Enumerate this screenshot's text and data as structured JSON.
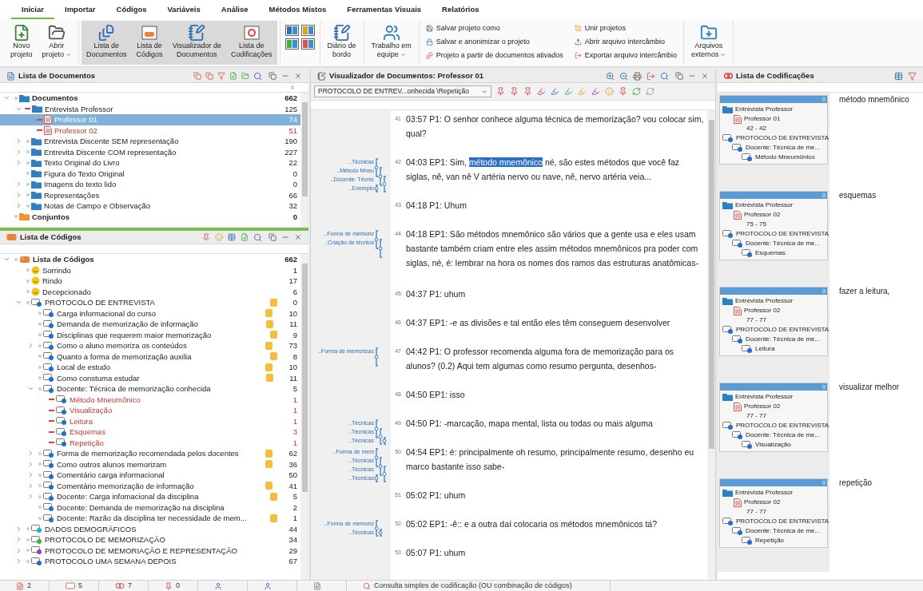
{
  "menu_tabs": [
    {
      "label": "Iniciar",
      "selected": true
    },
    {
      "label": "Importar",
      "selected": false
    },
    {
      "label": "Códigos",
      "selected": false
    },
    {
      "label": "Variáveis",
      "selected": false
    },
    {
      "label": "Análise",
      "selected": false
    },
    {
      "label": "Métodos Mistos",
      "selected": false
    },
    {
      "label": "Ferramentas Visuais",
      "selected": false
    },
    {
      "label": "Relatórios",
      "selected": false
    }
  ],
  "ribbon": [
    {
      "kind": "large",
      "buttons": [
        {
          "lines": [
            "Novo",
            "projeto"
          ],
          "dropdown": false,
          "on": false
        },
        {
          "lines": [
            "Abrir",
            "projeto"
          ],
          "dropdown": true,
          "on": false
        }
      ]
    },
    {
      "kind": "large",
      "buttons": [
        {
          "lines": [
            "Lista de",
            "Documentos"
          ],
          "dropdown": false,
          "on": true
        },
        {
          "lines": [
            "Lista de",
            "Códigos"
          ],
          "dropdown": false,
          "on": true
        },
        {
          "lines": [
            "Visualizador de",
            "Documentos"
          ],
          "dropdown": false,
          "on": true
        },
        {
          "lines": [
            "Lista de",
            "Codificações"
          ],
          "dropdown": false,
          "on": true
        }
      ]
    },
    {
      "kind": "layout_grid"
    },
    {
      "kind": "large",
      "buttons": [
        {
          "lines": [
            "Diário de",
            "bordo"
          ],
          "dropdown": false,
          "on": false
        }
      ]
    },
    {
      "kind": "large",
      "buttons": [
        {
          "lines": [
            "Trabalho em",
            "equipe"
          ],
          "dropdown": true,
          "on": false
        }
      ]
    },
    {
      "kind": "small",
      "columns": [
        [
          "Salvar projeto como",
          "Salvar e anonimizar o projeto",
          "Projeto a partir de documentos ativados"
        ],
        [
          "Unir projetos",
          "Abrir arquivo intercâmbio",
          "Exportar arquivo intercâmbio"
        ]
      ]
    },
    {
      "kind": "large",
      "buttons": [
        {
          "lines": [
            "Arquivos",
            "externos"
          ],
          "dropdown": true,
          "on": false
        }
      ]
    }
  ],
  "documents": {
    "title": "Lista de Documentos",
    "column_header": "#",
    "tree": [
      {
        "name": "Documentos",
        "count": "662",
        "kind": "root",
        "expanded": true,
        "selected": false,
        "children": [
          {
            "name": "Entrevista Professor",
            "count": "125",
            "kind": "folder",
            "expanded": true,
            "activated": true,
            "selected": false,
            "children": [
              {
                "name": "Professor 01",
                "count": "74",
                "kind": "document",
                "activated": true,
                "selected": true
              },
              {
                "name": "Professor 02",
                "count": "51",
                "kind": "document",
                "activated": true,
                "selected": false
              }
            ]
          },
          {
            "name": "Entrevista Discente SEM representação",
            "count": "190",
            "kind": "folder",
            "expanded": false,
            "selected": false
          },
          {
            "name": "Entrevita Discente COM representação",
            "count": "227",
            "kind": "folder",
            "expanded": false,
            "selected": false
          },
          {
            "name": "Texto Original do Livro",
            "count": "22",
            "kind": "folder",
            "expanded": false,
            "selected": false
          },
          {
            "name": "Figura do Texto Original",
            "count": "0",
            "kind": "folder",
            "selected": false
          },
          {
            "name": "Imagens do texto lido",
            "count": "0",
            "kind": "folder",
            "expanded": false,
            "selected": false
          },
          {
            "name": "Representações",
            "count": "66",
            "kind": "folder",
            "expanded": false,
            "selected": false
          },
          {
            "name": "Notas de Campo e Observação",
            "count": "32",
            "kind": "folder",
            "expanded": false,
            "selected": false
          }
        ]
      },
      {
        "name": "Conjuntos",
        "count": "0",
        "kind": "sets",
        "selected": false
      }
    ]
  },
  "codes": {
    "title": "Lista de Códigos",
    "tree": [
      {
        "name": "Lista de Códigos",
        "count": "662",
        "kind": "root",
        "expanded": true,
        "selected": false,
        "children": [
          {
            "name": "Sorrindo",
            "count": "1",
            "kind": "emoji",
            "selected": false
          },
          {
            "name": "Rindo",
            "count": "17",
            "kind": "emoji",
            "selected": false
          },
          {
            "name": "Decepcionado",
            "count": "6",
            "kind": "emoji",
            "selected": false
          },
          {
            "name": "PROTOCOLO DE ENTREVISTA",
            "count": "0",
            "kind": "code",
            "color": "#1f6fd1",
            "memo": true,
            "expanded": true,
            "selected": false,
            "children": [
              {
                "name": "Carga informacional do curso",
                "count": "10",
                "kind": "code",
                "color": "#1f6fd1",
                "memo": true,
                "selected": false
              },
              {
                "name": "Demanda de memorização de informação",
                "count": "11",
                "kind": "code",
                "color": "#1f6fd1",
                "memo": true,
                "selected": false
              },
              {
                "name": "Disciplinas que requerem maior memorização",
                "count": "9",
                "kind": "code",
                "color": "#1f6fd1",
                "memo": true,
                "selected": false
              },
              {
                "name": "Como o aluno memoriza os conteúdos",
                "count": "73",
                "kind": "code",
                "color": "#1f6fd1",
                "memo": true,
                "expanded": false,
                "selected": false
              },
              {
                "name": "Quanto a forma de memorização auxilia",
                "count": "8",
                "kind": "code",
                "color": "#1f6fd1",
                "memo": true,
                "selected": false
              },
              {
                "name": "Local de estudo",
                "count": "10",
                "kind": "code",
                "color": "#1f6fd1",
                "memo": true,
                "selected": false
              },
              {
                "name": "Como constuma estudar",
                "count": "11",
                "kind": "code",
                "color": "#1f6fd1",
                "memo": true,
                "selected": false
              },
              {
                "name": "Docente: Técnica de memorização conhecida",
                "count": "5",
                "kind": "code",
                "color": "#1f6fd1",
                "expanded": true,
                "selected": false,
                "children": [
                  {
                    "name": "Método Mneumônico",
                    "count": "1",
                    "kind": "code",
                    "color": "#1f6fd1",
                    "activated": true,
                    "selected": false
                  },
                  {
                    "name": "Visualização",
                    "count": "1",
                    "kind": "code",
                    "color": "#1f6fd1",
                    "activated": true,
                    "selected": false
                  },
                  {
                    "name": "Leitura",
                    "count": "1",
                    "kind": "code",
                    "color": "#1f6fd1",
                    "activated": true,
                    "selected": false
                  },
                  {
                    "name": "Esquemas",
                    "count": "3",
                    "kind": "code",
                    "color": "#1f6fd1",
                    "activated": true,
                    "selected": false
                  },
                  {
                    "name": "Repetição",
                    "count": "1",
                    "kind": "code",
                    "color": "#1f6fd1",
                    "activated": true,
                    "selected": false
                  }
                ]
              },
              {
                "name": "Forma de memorização recomendada pelos docentes",
                "count": "62",
                "kind": "code",
                "color": "#1f6fd1",
                "memo": true,
                "expanded": false,
                "selected": false
              },
              {
                "name": "Como outros alunos memorizam",
                "count": "36",
                "kind": "code",
                "color": "#1f6fd1",
                "memo": true,
                "expanded": false,
                "selected": false
              },
              {
                "name": "Comentário carga informacional",
                "count": "50",
                "kind": "code",
                "color": "#1f6fd1",
                "expanded": false,
                "selected": false
              },
              {
                "name": "Comentário memorização de informação",
                "count": "41",
                "kind": "code",
                "color": "#1f6fd1",
                "memo": true,
                "expanded": false,
                "selected": false
              },
              {
                "name": "Docente: Carga infomacional da disciplina",
                "count": "5",
                "kind": "code",
                "color": "#1f6fd1",
                "memo": true,
                "expanded": false,
                "selected": false
              },
              {
                "name": "Docente: Demanda de memorização na disciplina",
                "count": "2",
                "kind": "code",
                "color": "#1f6fd1",
                "selected": false
              },
              {
                "name": "Docente: Razão da disciplina ter necessidade de mem...",
                "count": "1",
                "kind": "code",
                "color": "#1f6fd1",
                "memo": true,
                "selected": false
              }
            ]
          },
          {
            "name": "DADOS DEMOGRÁFICOS",
            "count": "44",
            "kind": "code",
            "color": "#19b5c8",
            "expanded": false,
            "selected": false
          },
          {
            "name": "PROTOCOLO DE MEMORIZAÇÃO",
            "count": "34",
            "kind": "code",
            "color": "#3cb043",
            "expanded": false,
            "selected": false
          },
          {
            "name": "PROTOCOLO DE MEMORIAÇÃO E REPRESENTAÇÃO",
            "count": "29",
            "kind": "code",
            "color": "#9b3cc7",
            "expanded": false,
            "selected": false
          },
          {
            "name": "PROTOCOLO UMA SEMANA DEPOIS",
            "count": "67",
            "kind": "code",
            "color": "#1f6fd1",
            "expanded": false,
            "selected": false
          }
        ]
      }
    ]
  },
  "viewer": {
    "title": "Visualizador de Documentos: Professor 01",
    "code_selector": "PROTOCOLO DE ENTREV...onhecida \\Repetição",
    "paragraphs": [
      {
        "number": "41",
        "text": "03:57 P1: O senhor conhece alguma técnica de memorização? vou colocar sim, qual?"
      },
      {
        "number": "42",
        "segments": [
          {
            "text": "04:03 EP1: Sim, ",
            "selected": false
          },
          {
            "text": "método mnemônico",
            "selected": true
          },
          {
            "text": " né, são estes métodos que você faz siglas, nê, van nê V artéria nervo ou nave, nê, nervo artéria veia...",
            "selected": false
          }
        ],
        "codes": [
          "..Técnicas",
          "..Método Mneu",
          "..Docente: Técnic",
          "..Exemplo"
        ]
      },
      {
        "number": "43",
        "text": "04:18 P1: Uhum"
      },
      {
        "number": "44",
        "text": "04:18 EP1: São métodos mnemônico são vários que a gente usa e eles usam bastante também criam entre eles assim métodos mnemônicos pra poder com siglas, né, é: lembrar na hora os nomes dos ramos das estruturas anatômicas-",
        "codes": [
          "..Forma de memoriz",
          "..Criação de técnica"
        ]
      },
      {
        "number": "45",
        "text": "04:37 P1: uhum"
      },
      {
        "number": "46",
        "text": "04:37 EP1: -e as divisões e tal então eles têm conseguem desenvolver"
      },
      {
        "number": "47",
        "text": "04:42 P1: O professor recomenda alguma fora de memorização para os alunos? (0.2) Aqui tem algumas como resumo pergunta, desenhos-",
        "codes": [
          "..Forma de memorizac"
        ]
      },
      {
        "number": "48",
        "text": "04:50 EP1: isso"
      },
      {
        "number": "49",
        "text": "04:50 P1: -marcação, mapa mental, lista ou todas ou mais alguma",
        "codes": [
          "..Técnicas",
          "..Técnicas",
          "..Técnicas"
        ]
      },
      {
        "number": "50",
        "text": "04:54 EP1: é: principalmente oh resumo, principalmente resumo, desenho eu marco bastante isso sabe-",
        "codes": [
          "..Forma de mem",
          "..Técnicas",
          "..Técnicas",
          "..Técnicas"
        ]
      },
      {
        "number": "51",
        "text": "05:02 P1: uhum"
      },
      {
        "number": "52",
        "text": "05:02 EP1:  -ê:: e a outra daí colocaria os métodos mnemônicos tá?",
        "codes": [
          "..Forma de memoriz",
          "..Técnicas"
        ]
      },
      {
        "number": "53",
        "text": "05:07 P1: uhum"
      }
    ]
  },
  "codings": {
    "title": "Lista de Codificações",
    "items": [
      {
        "count": "0",
        "folder": "Entrevista Professor",
        "document": "Professor 01",
        "range": "42 - 42",
        "parent_code": "PROTOCOLO DE ENTREVISTA",
        "subcode": "Docente: Técnica de me...",
        "code": "Método Mneumônico",
        "excerpt": "método mnemônico"
      },
      {
        "count": "0",
        "folder": "Entrevista Professor",
        "document": "Professor 02",
        "range": "75 - 75",
        "parent_code": "PROTOCOLO DE ENTREVISTA",
        "subcode": "Docente: Técnica de me...",
        "code": "Esquemas",
        "excerpt": "esquemas"
      },
      {
        "count": "0",
        "folder": "Entrevista Professor",
        "document": "Professor 02",
        "range": "77 - 77",
        "parent_code": "PROTOCOLO DE ENTREVISTA",
        "subcode": "Docente: Técnica de me...",
        "code": "Leitura",
        "excerpt": "fazer a leitura,"
      },
      {
        "count": "0",
        "folder": "Entrevista Professor",
        "document": "Professor 02",
        "range": "77 - 77",
        "parent_code": "PROTOCOLO DE ENTREVISTA",
        "subcode": "Docente: Técnica de me...",
        "code": "Visualização",
        "excerpt": "visualizar melhor"
      },
      {
        "count": "0",
        "folder": "Entrevista Professor",
        "document": "Professor 02",
        "range": "77 - 77",
        "parent_code": "PROTOCOLO DE ENTREVISTA",
        "subcode": "Docente: Técnica de me...",
        "code": "Repetição",
        "excerpt": "repetição"
      }
    ]
  },
  "status_bar": [
    {
      "kind": "documents",
      "value": "2"
    },
    {
      "kind": "codes",
      "value": "5"
    },
    {
      "kind": "codings",
      "value": "7"
    },
    {
      "kind": "weights",
      "value": "0"
    },
    {
      "kind": "user"
    },
    {
      "kind": "user"
    },
    {
      "kind": "page"
    },
    {
      "kind": "query",
      "value": "Consulta simples de codificação (OU combinação de códigos)"
    }
  ]
}
